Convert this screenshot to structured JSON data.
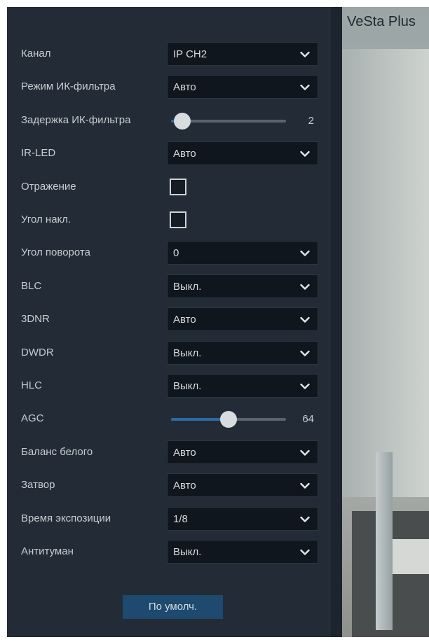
{
  "settings": {
    "rows": [
      {
        "label": "Канал",
        "type": "select",
        "value": "IP CH2"
      },
      {
        "label": "Режим ИК-фильтра",
        "type": "select",
        "value": "Авто"
      },
      {
        "label": "Задержка ИК-фильтра",
        "type": "slider",
        "value": "2",
        "fraction": 0.1
      },
      {
        "label": "IR-LED",
        "type": "select",
        "value": "Авто"
      },
      {
        "label": "Отражение",
        "type": "checkbox",
        "checked": false
      },
      {
        "label": "Угол накл.",
        "type": "checkbox",
        "checked": false
      },
      {
        "label": "Угол поворота",
        "type": "select",
        "value": "0"
      },
      {
        "label": "BLC",
        "type": "select",
        "value": "Выкл."
      },
      {
        "label": "3DNR",
        "type": "select",
        "value": "Авто"
      },
      {
        "label": "DWDR",
        "type": "select",
        "value": "Выкл."
      },
      {
        "label": "HLC",
        "type": "select",
        "value": "Выкл."
      },
      {
        "label": "AGC",
        "type": "slider",
        "value": "64",
        "fraction": 0.5
      },
      {
        "label": "Баланс белого",
        "type": "select",
        "value": "Авто"
      },
      {
        "label": "Затвор",
        "type": "select",
        "value": "Авто"
      },
      {
        "label": "Время экспозиции",
        "type": "select",
        "value": "1/8"
      },
      {
        "label": "Антитуман",
        "type": "select",
        "value": "Выкл."
      }
    ],
    "default_button": "По умолч."
  },
  "preview": {
    "brand": "VeSta Plus"
  },
  "colors": {
    "panel": "#232c36",
    "select_bg": "#10161d",
    "slider_fill": "#2d6aa3",
    "button": "#1d4a6e"
  }
}
